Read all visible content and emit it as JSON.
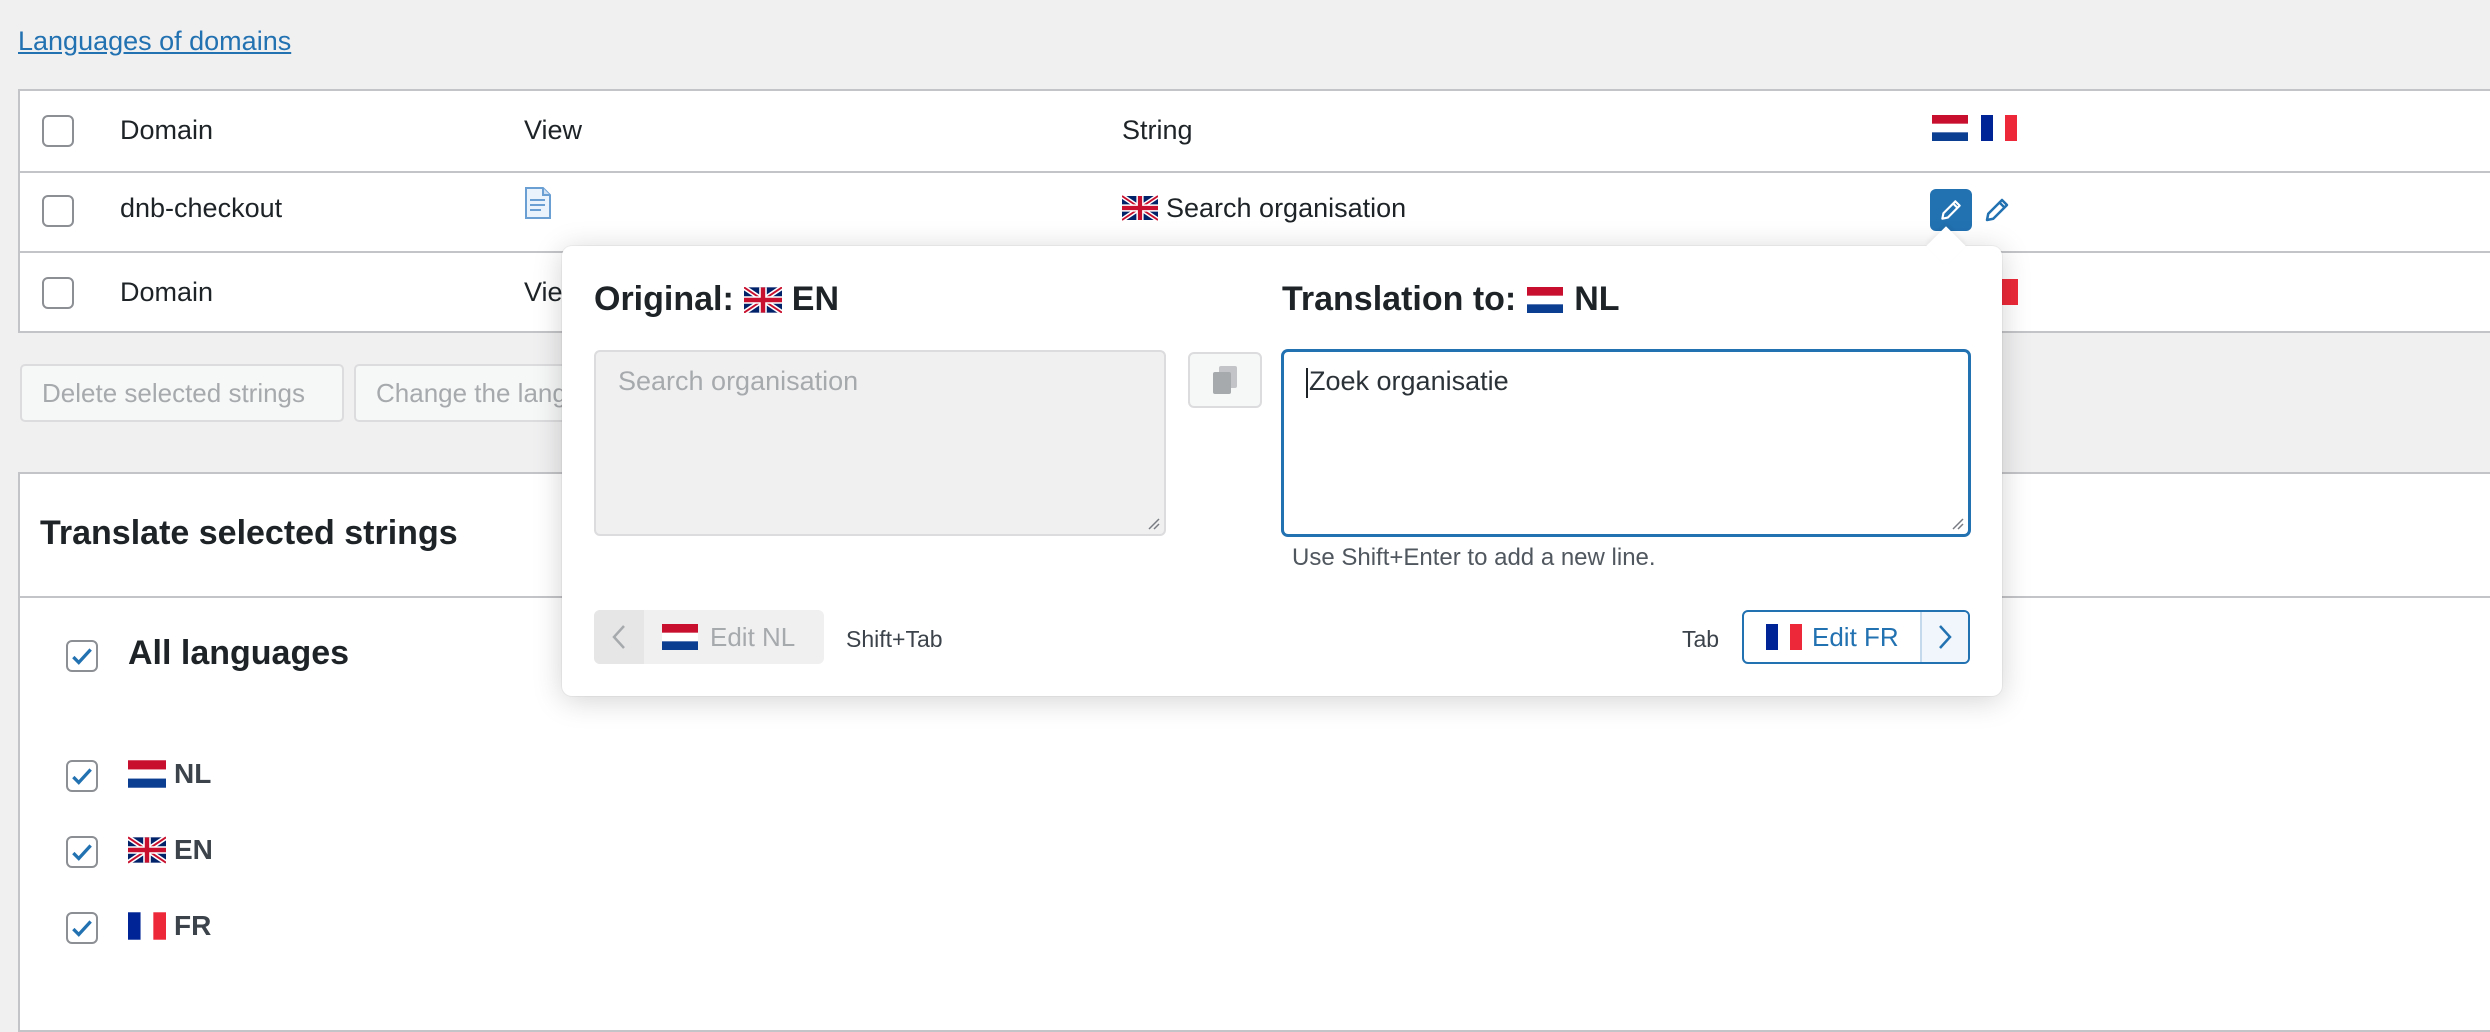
{
  "breadcrumb_link": "Languages of domains",
  "table": {
    "columns": {
      "domain": "Domain",
      "view": "View",
      "string": "String"
    },
    "rows": [
      {
        "domain": "dnb-checkout",
        "string": "Search organisation"
      }
    ],
    "footer": {
      "domain": "Domain",
      "view_partial": "Vie"
    }
  },
  "bulk_actions": {
    "delete": "Delete selected strings",
    "change_lang": "Change the lang"
  },
  "translate_panel": {
    "title": "Translate selected strings",
    "all_languages": "All languages",
    "languages": [
      {
        "code": "NL",
        "flag": "nl-flag",
        "checked": true
      },
      {
        "code": "EN",
        "flag": "gb-flag",
        "checked": true
      },
      {
        "code": "FR",
        "flag": "fr-flag",
        "checked": true
      }
    ]
  },
  "popover": {
    "original_label": "Original:",
    "original_lang": "EN",
    "translation_label": "Translation to:",
    "translation_lang": "NL",
    "source_text": "Search organisation",
    "translation_text": "Zoek organisatie",
    "hint": "Use Shift+Enter to add a new line.",
    "prev_label": "Edit NL",
    "prev_shortcut": "Shift+Tab",
    "next_shortcut": "Tab",
    "next_label": "Edit FR"
  },
  "colors": {
    "accent": "#2271b1",
    "background": "#f0f0f1",
    "border": "#c3c4c7"
  }
}
